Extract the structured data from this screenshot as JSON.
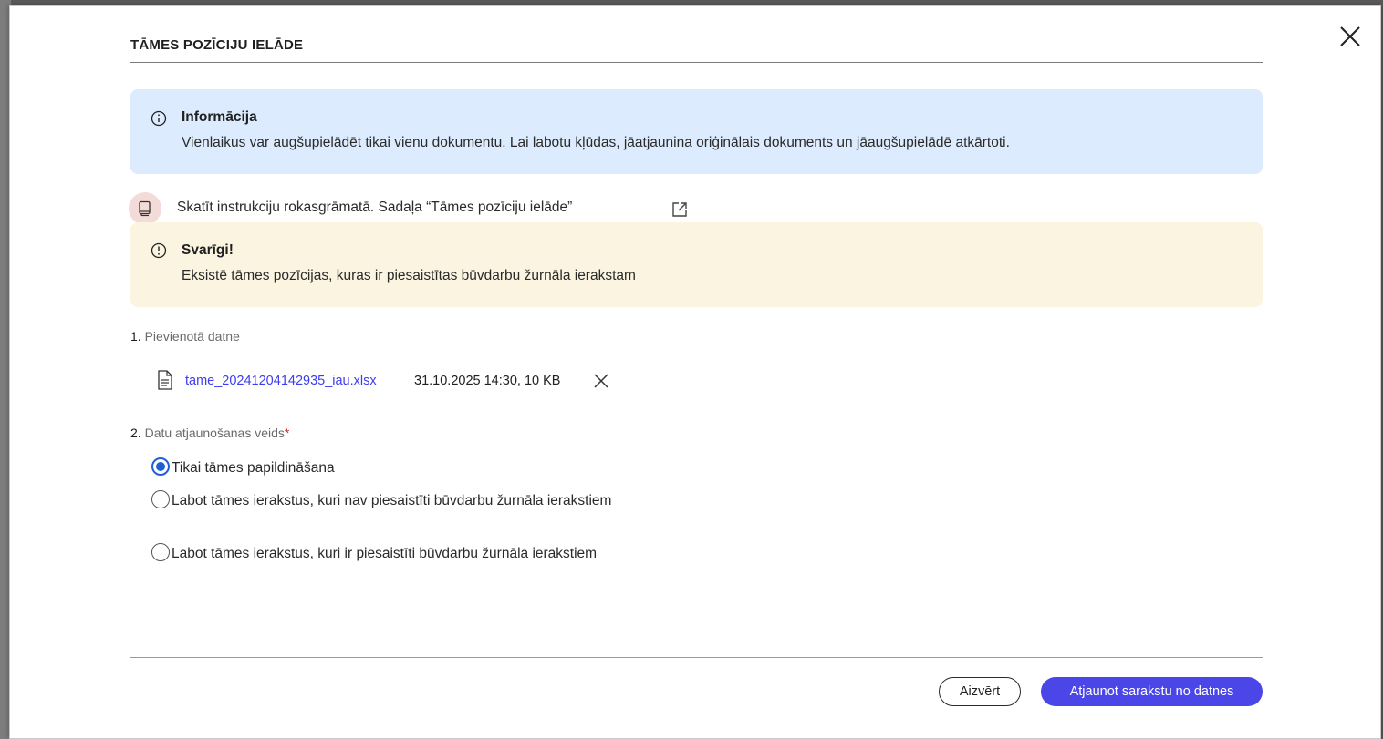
{
  "dialog": {
    "title": "TĀMES POZĪCIJU IELĀDE"
  },
  "info": {
    "icon": "info-circle-icon",
    "title": "Informācija",
    "text": "Vienlaikus var augšupielādēt tikai vienu dokumentu. Lai labotu kļūdas, jāatjaunina oriģinālais dokuments un jāaugšupielādē atkārtoti."
  },
  "manual": {
    "icon": "book-icon",
    "text": "Skatīt instrukciju rokasgrāmatā. Sadaļa “Tāmes pozīciju ielāde”",
    "link_icon": "external-link-icon"
  },
  "warning": {
    "icon": "exclamation-circle-icon",
    "title": "Svarīgi!",
    "text": "Eksistē tāmes pozīcijas, kuras ir piesaistītas būvdarbu žurnāla ierakstam"
  },
  "step1": {
    "number": "1.",
    "label": "Pievienotā datne"
  },
  "file": {
    "name": "tame_20241204142935_iau.xlsx",
    "meta": "31.10.2025 14:30, 10 KB"
  },
  "step2": {
    "number": "2.",
    "label": "Datu atjaunošanas veids",
    "required_mark": "*"
  },
  "update_options": [
    {
      "label": "Tikai tāmes papildināšana",
      "selected": true
    },
    {
      "label": "Labot tāmes ierakstus, kuri nav piesaistīti būvdarbu žurnāla ierakstiem",
      "selected": false
    },
    {
      "label": "Labot tāmes ierakstus, kuri ir piesaistīti būvdarbu žurnāla ierakstiem",
      "selected": false
    }
  ],
  "footer": {
    "close_label": "Aizvērt",
    "submit_label": "Atjaunot sarakstu no datnes"
  },
  "colors": {
    "primary": "#4b46e8",
    "info_bg": "#dcebfd",
    "warning_bg": "#faf4e0",
    "link": "#3d3df0",
    "radio_selected": "#1f5fd6"
  }
}
